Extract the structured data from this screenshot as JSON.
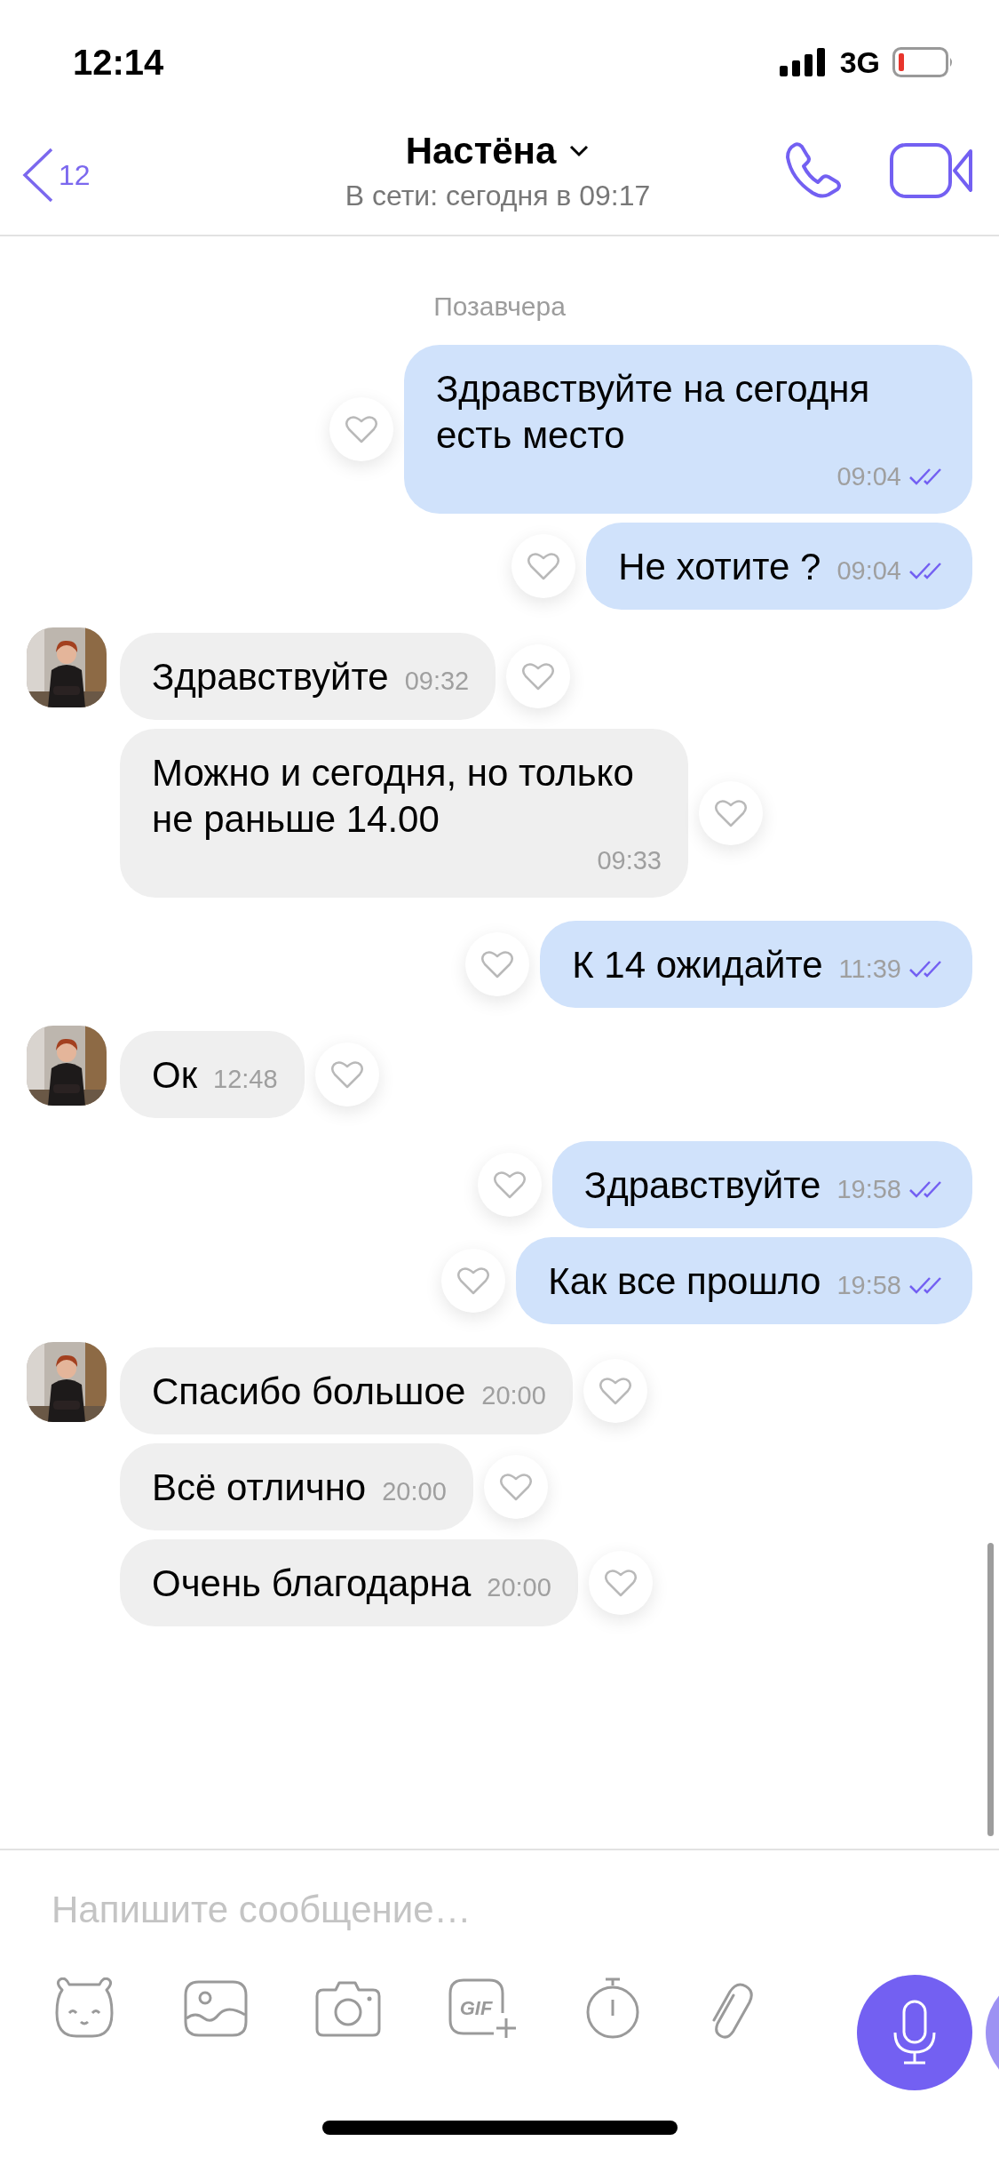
{
  "status_bar": {
    "time": "12:14",
    "network": "3G"
  },
  "header": {
    "back_count": "12",
    "title": "Настёна",
    "subtitle": "В сети: сегодня в 09:17"
  },
  "messages": [
    {
      "kind": "date",
      "text": "Позавчера"
    },
    {
      "kind": "outgoing",
      "text": "Здравствуйте на сегодня есть место",
      "time": "09:04"
    },
    {
      "kind": "outgoing",
      "text": "Не хотите ?",
      "time": "09:04"
    },
    {
      "kind": "incoming",
      "text": "Здравствуйте",
      "time": "09:32",
      "avatar": true
    },
    {
      "kind": "incoming",
      "text": "Можно и сегодня, но только не раньше 14.00",
      "time": "09:33",
      "avatar": false
    },
    {
      "kind": "outgoing",
      "text": "К 14 ожидайте",
      "time": "11:39"
    },
    {
      "kind": "incoming",
      "text": "Ок",
      "time": "12:48",
      "avatar": true
    },
    {
      "kind": "outgoing",
      "text": "Здравствуйте",
      "time": "19:58"
    },
    {
      "kind": "outgoing",
      "text": "Как все прошло",
      "time": "19:58"
    },
    {
      "kind": "incoming",
      "text": "Спасибо большое",
      "time": "20:00",
      "avatar": true
    },
    {
      "kind": "incoming",
      "text": "Всё отлично",
      "time": "20:00",
      "avatar": false
    },
    {
      "kind": "incoming",
      "text": "Очень благодарна",
      "time": "20:00",
      "avatar": false
    }
  ],
  "composer": {
    "placeholder": "Напишите сообщение…",
    "gif_label": "GIF"
  }
}
